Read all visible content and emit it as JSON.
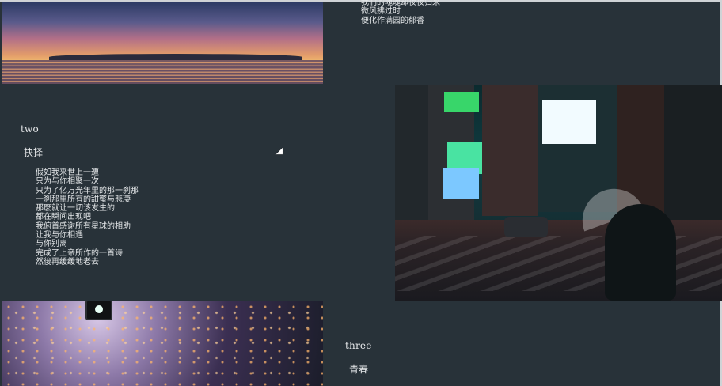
{
  "sections": {
    "two": {
      "number": "two",
      "title": "抉择",
      "lines": [
        "假如我来世上一遭",
        "只为与你相聚一次",
        "只为了亿万光年里的那一刹那",
        "一刹那里所有的甜蜜与悲凄",
        "那麽就让一切该发生的",
        "都在瞬间出现吧",
        "我俯首感谢所有星球的相助",
        "让我与你相遇",
        "与你别离",
        "完成了上帝所作的一首诗",
        "然後再缓缓地老去"
      ]
    },
    "top_right_poem": {
      "lines": [
        "我们的魂魄却夜夜归来",
        "微风拂过时",
        "便化作满园的郁香"
      ]
    },
    "three": {
      "number": "three",
      "title": "青春"
    }
  },
  "images": {
    "sunset": {
      "name": "sunset-photo"
    },
    "city": {
      "name": "city-night-photo"
    },
    "trees": {
      "name": "night-trees-photo"
    }
  }
}
